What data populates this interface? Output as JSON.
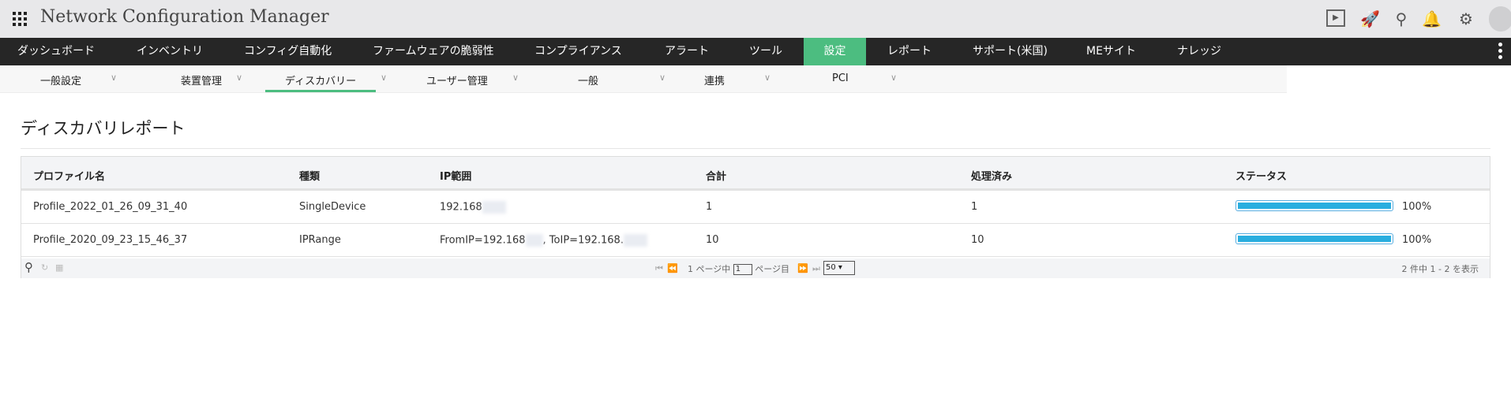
{
  "app": {
    "title": "Network Configuration Manager",
    "icons": [
      "presentation-icon",
      "rocket-icon",
      "search-icon",
      "bell-icon",
      "gear-icon",
      "avatar-icon"
    ]
  },
  "nav": {
    "items": [
      "ダッシュボード",
      "インベントリ",
      "コンフィグ自動化",
      "ファームウェアの脆弱性",
      "コンプライアンス",
      "アラート",
      "ツール",
      "設定",
      "レポート",
      "サポート(米国)",
      "MEサイト",
      "ナレッジ"
    ],
    "active": "設定"
  },
  "subnav": {
    "items": [
      "一般設定",
      "装置管理",
      "ディスカバリー",
      "ユーザー管理",
      "一般",
      "連携",
      "PCI"
    ],
    "active": "ディスカバリー"
  },
  "page": {
    "title": "ディスカバリレポート"
  },
  "table": {
    "headers": [
      "プロファイル名",
      "種類",
      "IP範囲",
      "合計",
      "処理済み",
      "ステータス"
    ],
    "rows": [
      {
        "name": "Profile_2022_01_26_09_31_40",
        "type": "SingleDevice",
        "ip1": "192.168",
        "ip2": "",
        "total": "1",
        "processed": "1",
        "progress": 100,
        "status": "100%"
      },
      {
        "name": "Profile_2020_09_23_15_46_37",
        "type": "IPRange",
        "ip1": "FromIP=192.168",
        "ip2": ", ToIP=192.168.",
        "total": "10",
        "processed": "10",
        "progress": 100,
        "status": "100%"
      }
    ]
  },
  "footer": {
    "page_of": "1 ページ中",
    "page_value": "1",
    "page_suffix": "ページ目",
    "page_size": "50",
    "summary": "2 件中 1 - 2 を表示"
  },
  "colors": {
    "accent": "#4cbd80",
    "progress": "#2aaedf",
    "nav_bg": "#262626"
  }
}
